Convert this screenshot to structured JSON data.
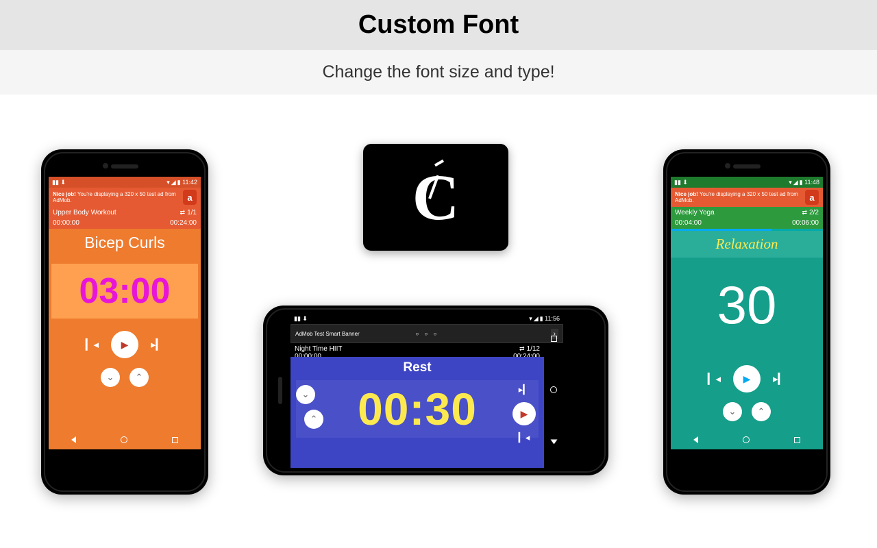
{
  "header": {
    "title": "Custom Font",
    "subtitle": "Change the font size and type!"
  },
  "phone1": {
    "status": {
      "time": "11:42"
    },
    "ad": {
      "bold": "Nice job!",
      "text": " You're displaying a 320 x 50 test ad from AdMob."
    },
    "workout": {
      "name": "Upper Body Workout",
      "count": "1/1",
      "elapsed": "00:00:00",
      "total": "00:24:00"
    },
    "exercise": "Bicep Curls",
    "timer": "03:00"
  },
  "phone2": {
    "status": {
      "time": "11:56"
    },
    "ad": {
      "text": "AdMob Test Smart Banner"
    },
    "workout": {
      "name": "Night Time HIIT",
      "count": "1/12",
      "elapsed": "00:00:00",
      "total": "00:24:00"
    },
    "exercise": "Rest",
    "timer": "00:30"
  },
  "phone3": {
    "status": {
      "time": "11:48"
    },
    "ad": {
      "bold": "Nice job!",
      "text": " You're displaying a 320 x 50 test ad from AdMob."
    },
    "workout": {
      "name": "Weekly Yoga",
      "count": "2/2",
      "elapsed": "00:04:00",
      "total": "00:06:00"
    },
    "exercise": "Relaxation",
    "timer": "30"
  }
}
